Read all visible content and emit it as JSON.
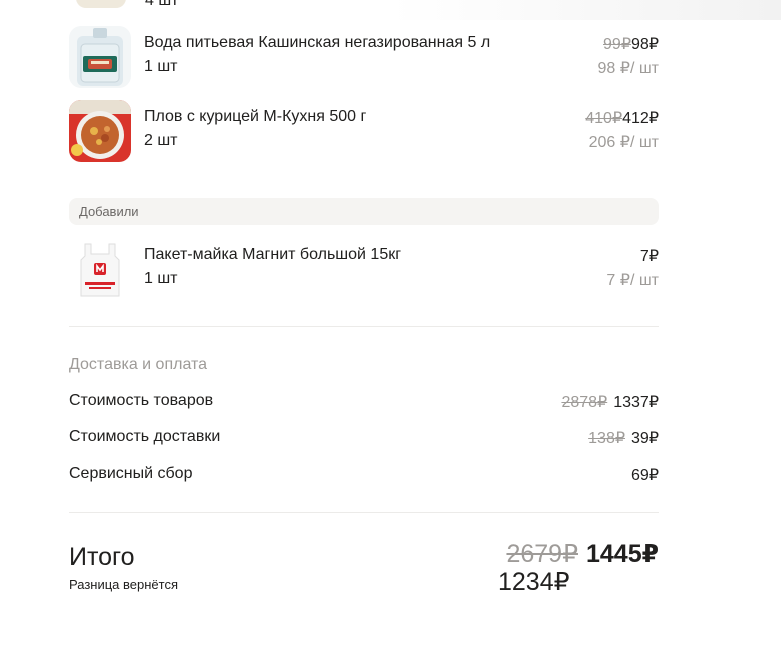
{
  "cut_item": {
    "qty": "4 шт"
  },
  "items": [
    {
      "name": "Вода питьевая Кашинская негазированная 5 л",
      "qty": "1 шт",
      "old_price": "99₽",
      "price": "98₽",
      "unit_price": "98 ₽/ шт",
      "image_icon": "water-bottle-icon"
    },
    {
      "name": "Плов с курицей М-Кухня 500 г",
      "qty": "2 шт",
      "old_price": "410₽",
      "price": "412₽",
      "unit_price": "206 ₽/ шт",
      "image_icon": "plov-dish-icon"
    }
  ],
  "added_section": {
    "label": "Добавили",
    "item": {
      "name": "Пакет-майка Магнит большой 15кг",
      "qty": "1 шт",
      "price": "7₽",
      "unit_price": "7 ₽/ шт",
      "image_icon": "plastic-bag-icon"
    }
  },
  "delivery": {
    "title": "Доставка и оплата",
    "rows": [
      {
        "label": "Стоимость товаров",
        "old": "2878₽",
        "value": "1337₽"
      },
      {
        "label": "Стоимость доставки",
        "old": "138₽",
        "value": "39₽"
      },
      {
        "label": "Сервисный сбор",
        "old": "",
        "value": "69₽"
      }
    ]
  },
  "total": {
    "title": "Итого",
    "note": "Разница вернётся",
    "old": "2679₽",
    "value": "1445₽",
    "paid": "1234₽"
  },
  "colors": {
    "text": "#21201f",
    "muted": "#9e9b98",
    "section_bg": "#f5f4f2",
    "divider": "#ecebe9"
  }
}
